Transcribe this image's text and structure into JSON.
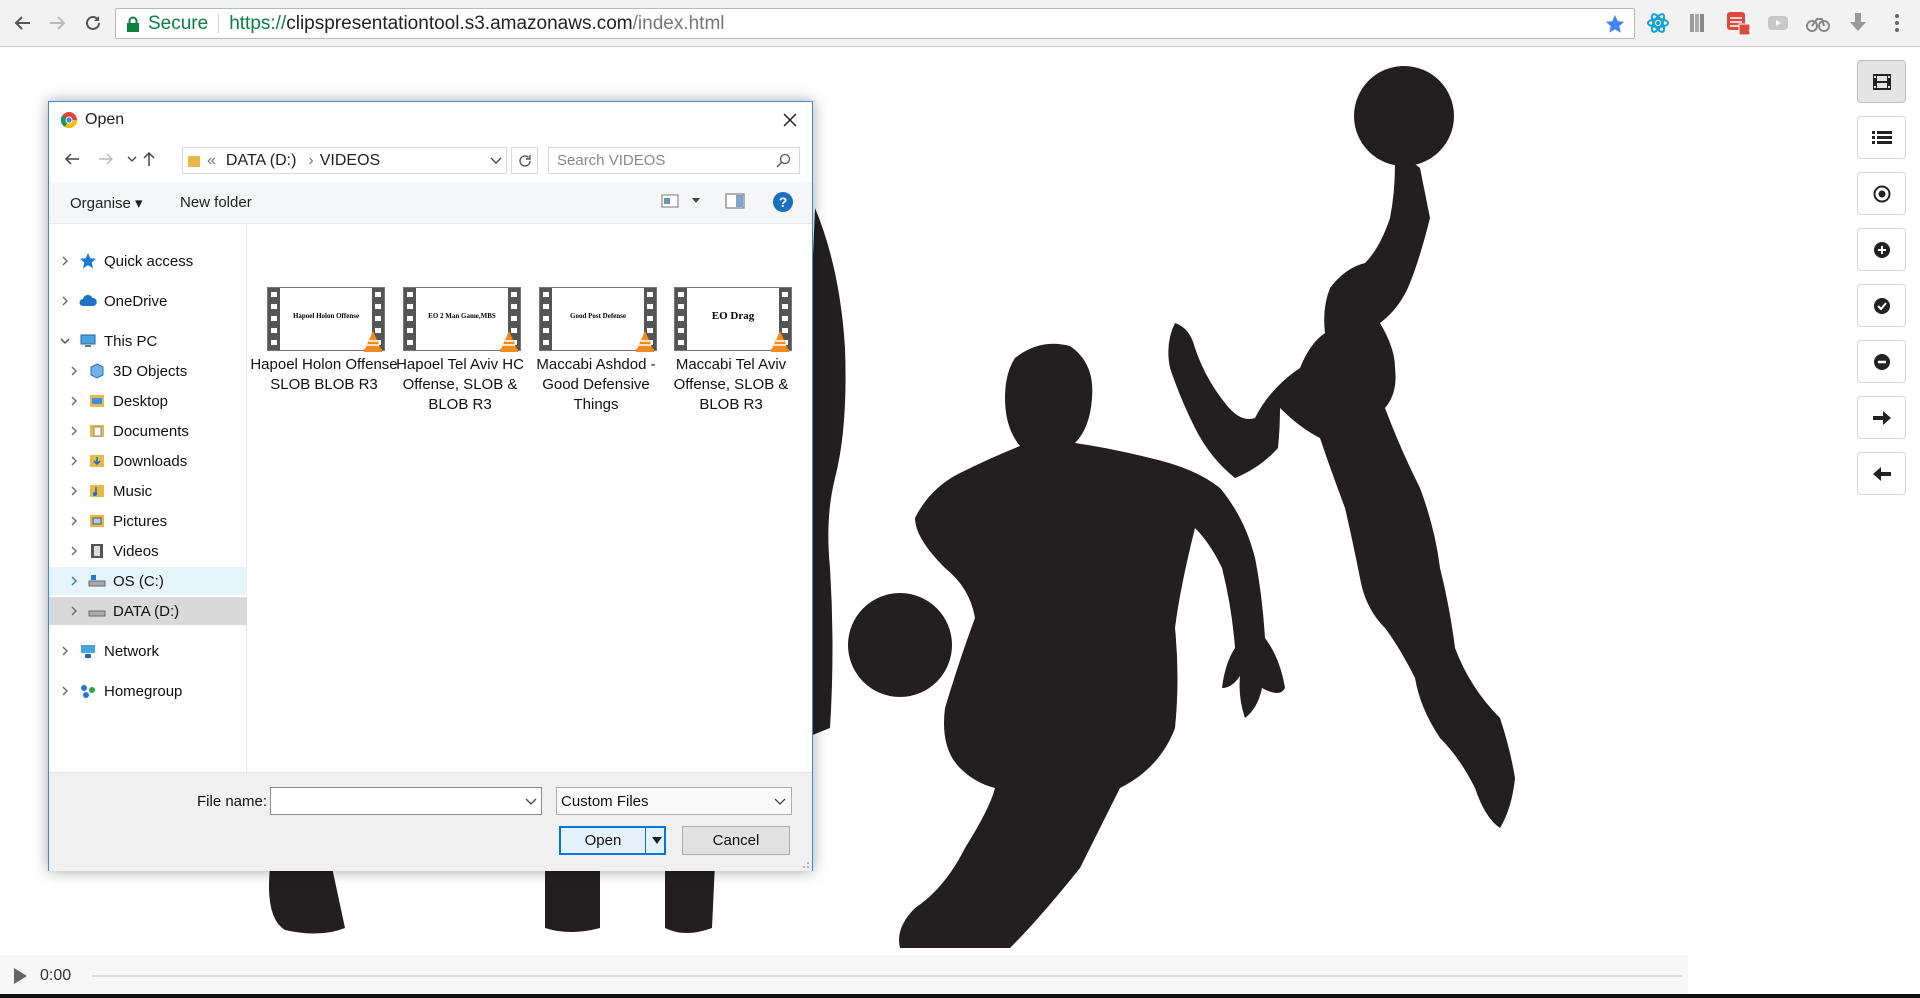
{
  "browser": {
    "secure_label": "Secure",
    "url_scheme": "https://",
    "url_host": "clipspresentationtool.s3.amazonaws.com",
    "url_path": "/index.html",
    "accent_color": "#0b8043",
    "extensions": [
      "react-devtools-icon",
      "books-icon",
      "todoist-icon",
      "video-icon",
      "bike-icon",
      "download-icon"
    ],
    "todoist_badge": "2"
  },
  "page": {
    "tools": [
      "film-icon",
      "list-icon",
      "target-icon",
      "plus-circle-icon",
      "check-circle-icon",
      "minus-circle-icon",
      "arrow-right-icon",
      "arrow-left-icon"
    ],
    "video": {
      "time": "0:00"
    }
  },
  "dialog": {
    "title": "Open",
    "breadcrumb": {
      "prefix": "«",
      "drive": "DATA (D:)",
      "folder": "VIDEOS"
    },
    "search_placeholder": "Search VIDEOS",
    "organise_label": "Organise ▾",
    "new_folder_label": "New folder",
    "nav": [
      {
        "label": "Quick access",
        "icon": "star-icon"
      },
      {
        "label": "OneDrive",
        "icon": "cloud-icon"
      },
      {
        "label": "This PC",
        "icon": "computer-icon"
      },
      {
        "label": "3D Objects",
        "icon": "cube-icon"
      },
      {
        "label": "Desktop",
        "icon": "folder-icon"
      },
      {
        "label": "Documents",
        "icon": "documents-icon"
      },
      {
        "label": "Downloads",
        "icon": "download-folder-icon"
      },
      {
        "label": "Music",
        "icon": "music-folder-icon"
      },
      {
        "label": "Pictures",
        "icon": "pictures-folder-icon"
      },
      {
        "label": "Videos",
        "icon": "videos-folder-icon"
      },
      {
        "label": "OS (C:)",
        "icon": "drive-icon"
      },
      {
        "label": "DATA (D:)",
        "icon": "drive-icon"
      },
      {
        "label": "Network",
        "icon": "network-icon"
      },
      {
        "label": "Homegroup",
        "icon": "homegroup-icon"
      }
    ],
    "files": [
      {
        "name": "Hapoel Holon Offense SLOB BLOB R3",
        "thumb_text": "Hapoel Holon Offense"
      },
      {
        "name": "Hapoel Tel Aviv HC Offense, SLOB & BLOB R3",
        "thumb_text": "EO 2 Man Game,MBS"
      },
      {
        "name": "Maccabi Ashdod - Good Defensive Things",
        "thumb_text": "Good Post Defense"
      },
      {
        "name": "Maccabi Tel Aviv Offense, SLOB & BLOB R3",
        "thumb_text": "EO Drag"
      }
    ],
    "file_name_label": "File name:",
    "file_name_value": "",
    "filter_value": "Custom Files",
    "open_label": "Open",
    "cancel_label": "Cancel"
  }
}
